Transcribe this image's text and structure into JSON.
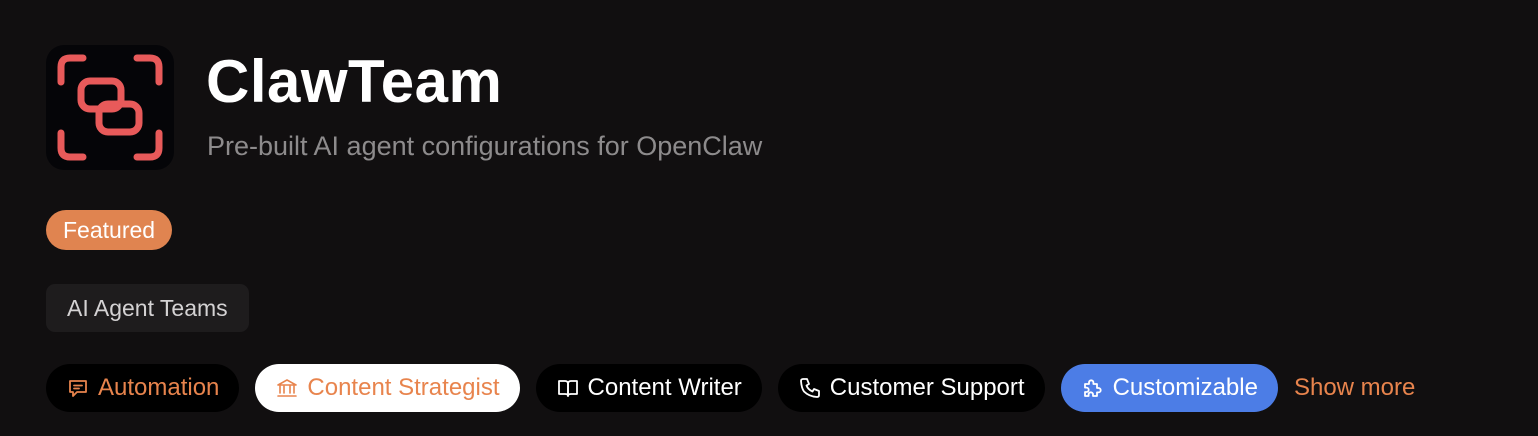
{
  "app": {
    "name": "ClawTeam",
    "tagline": "Pre-built AI agent configurations for OpenClaw",
    "logo_icon": "claw-scan-logo-icon"
  },
  "badges": {
    "featured": "Featured",
    "category": "AI Agent Teams"
  },
  "tags": [
    {
      "label": "Automation",
      "icon": "chat-bubble-icon"
    },
    {
      "label": "Content Strategist",
      "icon": "bank-icon"
    },
    {
      "label": "Content Writer",
      "icon": "open-book-icon"
    },
    {
      "label": "Customer Support",
      "icon": "phone-icon"
    },
    {
      "label": "Customizable",
      "icon": "puzzle-icon"
    }
  ],
  "show_more": "Show more",
  "colors": {
    "background": "#110f10",
    "accent_orange": "#e8844d",
    "featured_badge": "#e08450",
    "logo_red": "#e85a5a",
    "customizable_blue": "#4c7de6"
  }
}
